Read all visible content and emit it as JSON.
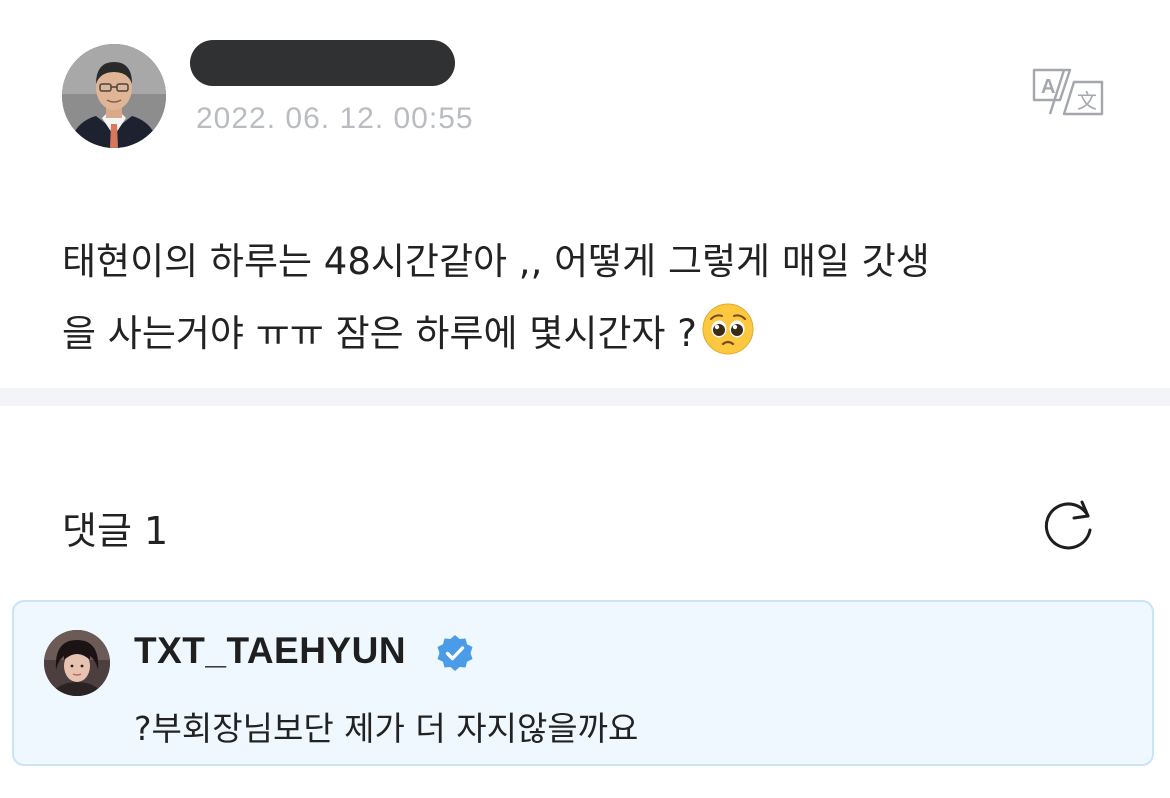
{
  "post": {
    "timestamp": "2022. 06. 12. 00:55",
    "body": "태현이의 하루는 48시간같아 ,, 어떻게 그렇게 매일 갓생\n을 사는거야 ㅠㅠ 잠은 하루에 몇시간자 ?",
    "emoji": "pleading-face-icon",
    "author_name_redacted": true
  },
  "comments": {
    "header": "댓글 1",
    "items": [
      {
        "author": "TXT_TAEHYUN",
        "verified": true,
        "text": "?부회장님보단 제가 더 자지않을까요"
      }
    ]
  },
  "icons": {
    "translate": "translate-icon",
    "refresh": "refresh-icon",
    "verified": "verified-badge-icon"
  },
  "colors": {
    "timestamp": "#b9bcc1",
    "separator": "#f3f4f7",
    "comment_background": "#eef8fe",
    "comment_border": "#c9e4f4",
    "verified_blue": "#4a9be8"
  }
}
